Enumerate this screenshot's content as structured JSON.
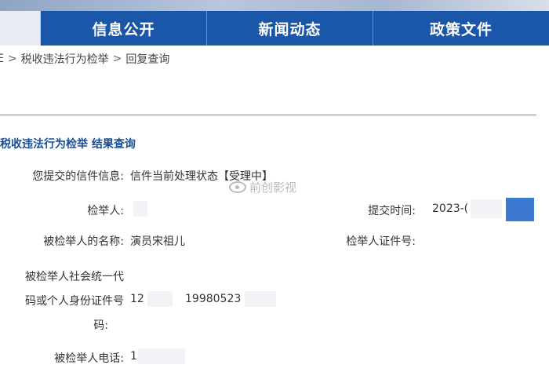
{
  "nav": {
    "items": [
      "信息公开",
      "新闻动态",
      "政策文件"
    ]
  },
  "breadcrumb": {
    "prefix": "E",
    "items": [
      "税收违法行为检举",
      "回复查询"
    ],
    "separator": ">"
  },
  "section": {
    "title": "税收违法行为检举 结果查询"
  },
  "fields": {
    "letter_info_label": "您提交的信件信息:",
    "letter_info_value": "信件当前处理状态【受理中】",
    "reporter_label": "检举人:",
    "submit_time_label": "提交时间:",
    "submit_time_value": "2023-(",
    "reported_name_label": "被检举人的名称:",
    "reported_name_value": "演员宋祖儿",
    "reporter_id_label": "检举人证件号:",
    "reported_code_label_1": "被检举人社会统一代",
    "reported_code_label_2": "码或个人身份证件号",
    "reported_code_label_3": "码:",
    "reported_code_value_a": "12",
    "reported_code_value_b": "19980523",
    "reported_phone_label": "被检举人电话:",
    "reported_phone_value": "1"
  },
  "watermark": {
    "text": "前创影视"
  },
  "colors": {
    "nav_bg": "#1a57a8",
    "section_title": "#1a4f96",
    "accent_block": "#3b78cf"
  }
}
